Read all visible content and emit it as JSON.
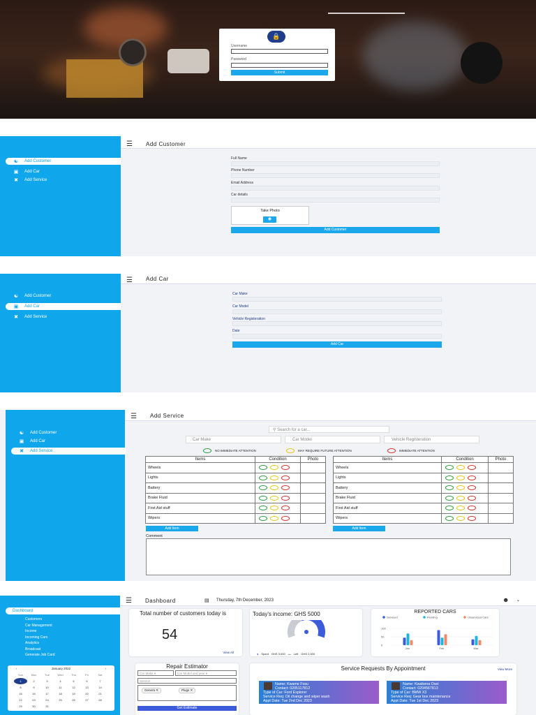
{
  "login": {
    "username_label": "Username",
    "password_label": "Password",
    "submit_label": "Submit"
  },
  "add_customer": {
    "title": "Add Customer",
    "nav": [
      "Add Customer",
      "Add Car",
      "Add Service"
    ],
    "fields": [
      "Full Name",
      "Phone Number",
      "Email Address",
      "Car details"
    ],
    "take_photo": "Take Photo",
    "submit": "Add Customer"
  },
  "add_car": {
    "title": "Add Car",
    "nav": [
      "Add Customer",
      "Add Car",
      "Add Service"
    ],
    "fields": [
      "Car Make",
      "Car Model",
      "Vehicle Registeration",
      "Date"
    ],
    "submit": "Add Car"
  },
  "add_service": {
    "title": "Add Service",
    "nav": [
      "Add Customer",
      "Add Car",
      "Add Service"
    ],
    "search_placeholder": "Search for a car...",
    "filters": [
      "Car Make",
      "Car Model",
      "Vehicle Registeration"
    ],
    "legend": [
      "NO IMMEDIATE ATTENTION",
      "MAY REQUIRE FUTURE ATTENTION",
      "IMMEDIATE ATTENTION"
    ],
    "headers": [
      "Items",
      "Condition",
      "Photo"
    ],
    "items": [
      "Wheels",
      "Lights",
      "Battery",
      "Brake Fluid",
      "First Aid stuff",
      "Wipers"
    ],
    "add_item": "Add Item",
    "comment": "Comment"
  },
  "dashboard": {
    "title": "Dashboard",
    "date": "Thursday, 7th December, 2023",
    "nav": [
      "Dashboard",
      "Customers",
      "Car Management",
      "Income",
      "Incoming Cars",
      "Analytics",
      "Broadcast",
      "Generate Job Card"
    ],
    "calendar": {
      "month": "January 2022",
      "days": [
        "Sun",
        "Mon",
        "Tue",
        "Wed",
        "Thu",
        "Fri",
        "Sat"
      ],
      "weeks": [
        [
          "1",
          "2",
          "3",
          "4",
          "5",
          "6",
          "7"
        ],
        [
          "8",
          "9",
          "10",
          "11",
          "12",
          "13",
          "14"
        ],
        [
          "15",
          "16",
          "17",
          "18",
          "19",
          "20",
          "21"
        ],
        [
          "22",
          "23",
          "24",
          "25",
          "26",
          "27",
          "28"
        ],
        [
          "29",
          "30",
          "31",
          "",
          "",
          "",
          ""
        ]
      ]
    },
    "customers_card": {
      "title": "Total number of customers today is",
      "value": "54",
      "link": "View All"
    },
    "income_card": {
      "title": "Today's income: GHS 5000",
      "spent_label": "Spent",
      "spent": "GHS 3,000",
      "left_label": "Left",
      "left": "GHS 2,000",
      "spent_fraction": 0.6
    },
    "reported": {
      "title": "REPORTED CARS",
      "legend": [
        "Serviced",
        "Pending",
        "Unserviced Cars"
      ]
    },
    "estimator": {
      "title": "Repair Estimator",
      "make_placeholder": "Car Make",
      "model_placeholder": "Car Model and year",
      "service_placeholder": "Service",
      "tags": [
        "Genera",
        "Plugs"
      ],
      "button": "Get Estimate"
    },
    "appointments": {
      "title": "Service Requests By Appointment",
      "link": "View More",
      "cards": [
        {
          "name": "Name: Kwame Fosu",
          "contact": "Contact: 0205117812",
          "car": "Type of Car: Ford Explorer",
          "request": "Service Req: Oil change and wiper wash",
          "date": "Appt Date: Tue 2nd Dec 2023"
        },
        {
          "name": "Name: Kwabena Osei",
          "contact": "Contact: 0204567813",
          "car": "Type of Car: BMW X3",
          "request": "Service Req: Gear box maintenance",
          "date": "Appt Date: Tue 1st Dec 2023"
        }
      ]
    }
  },
  "chart_data": {
    "type": "bar",
    "title": "REPORTED CARS",
    "categories": [
      "Jan",
      "Feb",
      "Mar"
    ],
    "ylim": [
      0,
      150
    ],
    "yticks": [
      "0",
      "50",
      "100"
    ],
    "series": [
      {
        "name": "Serviced",
        "values": [
          45,
          90,
          35
        ],
        "color": "#3b5bdb"
      },
      {
        "name": "Pending",
        "values": [
          70,
          45,
          55
        ],
        "color": "#1fb6d9"
      },
      {
        "name": "Unserviced Cars",
        "values": [
          30,
          65,
          30
        ],
        "color": "#f08a6b"
      }
    ]
  },
  "colors": {
    "accent": "#0fa6ec",
    "button": "#1aa7ec",
    "dark_blue": "#1f3d8a"
  }
}
